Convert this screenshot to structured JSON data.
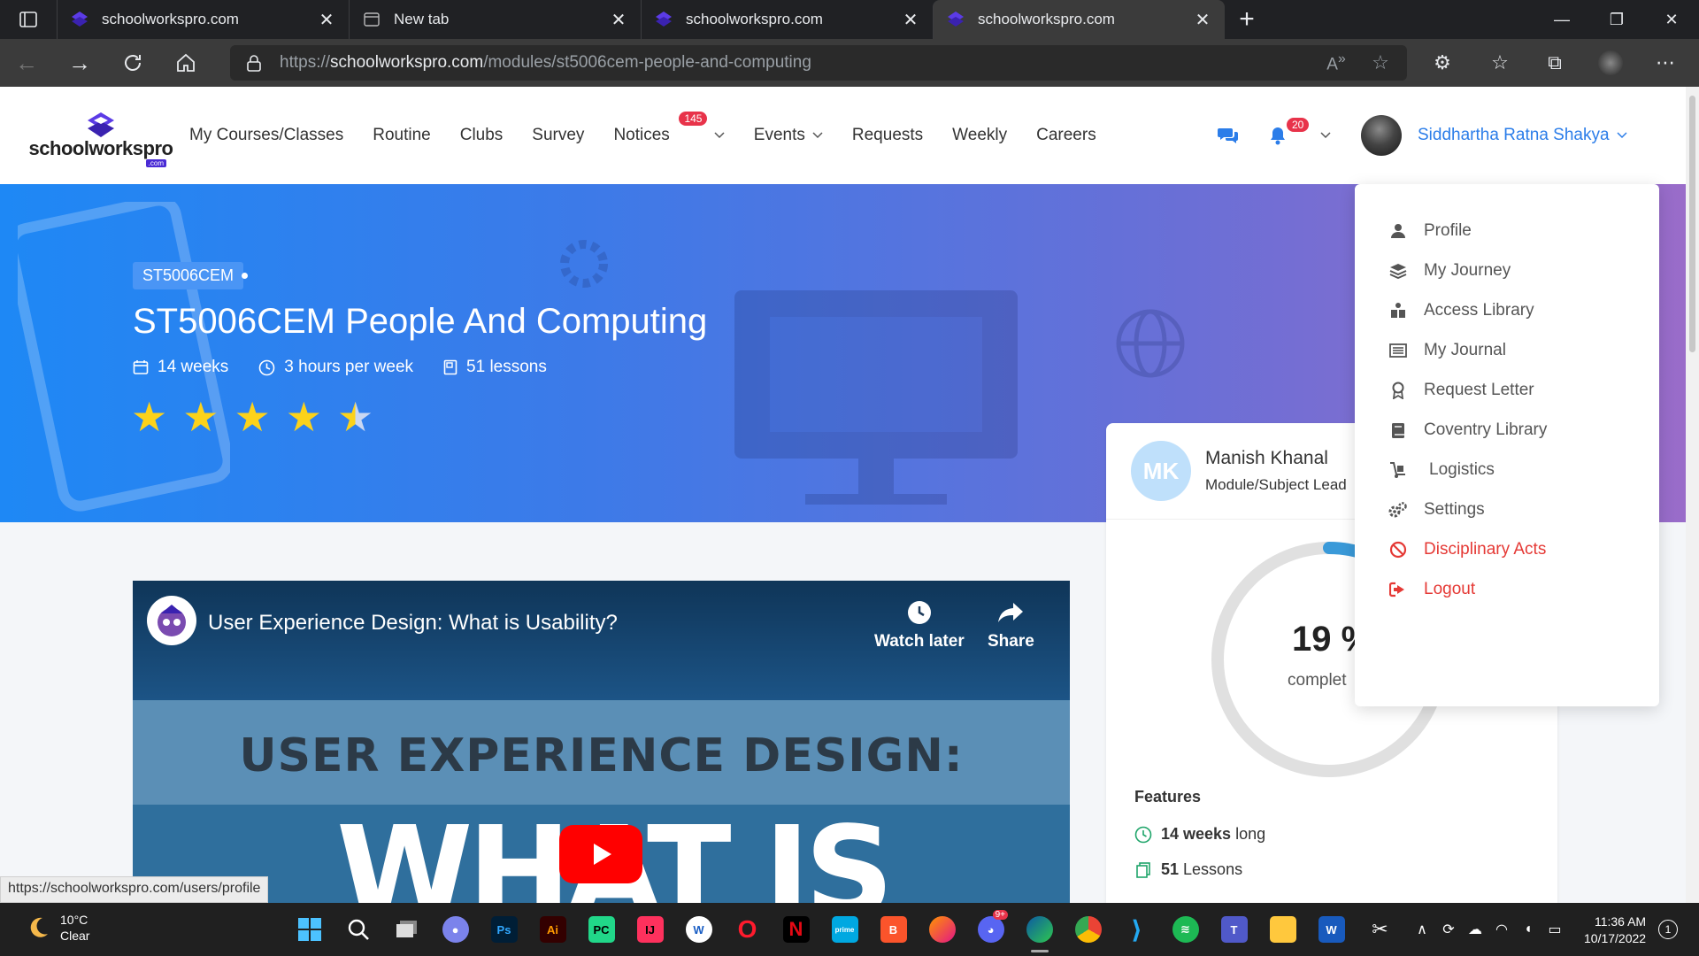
{
  "browser": {
    "tabs": [
      {
        "title": "schoolworkspro.com",
        "icon": "schoolworkspro-icon",
        "active": false
      },
      {
        "title": "New tab",
        "icon": "new-tab-page-icon",
        "active": false
      },
      {
        "title": "schoolworkspro.com",
        "icon": "schoolworkspro-icon",
        "active": false
      },
      {
        "title": "schoolworkspro.com",
        "icon": "schoolworkspro-icon",
        "active": true
      }
    ],
    "url": {
      "scheme": "https://",
      "host": "schoolworkspro.com",
      "path": "/modules/st5006cem-people-and-computing"
    }
  },
  "site": {
    "logo_text": "schoolworkspro",
    "logo_sub": ".com",
    "nav": [
      {
        "label": "My Courses/Classes"
      },
      {
        "label": "Routine"
      },
      {
        "label": "Clubs"
      },
      {
        "label": "Survey"
      },
      {
        "label": "Notices",
        "badge": "145"
      },
      {
        "label": "Events"
      },
      {
        "label": "Requests"
      },
      {
        "label": "Weekly"
      },
      {
        "label": "Careers"
      }
    ],
    "notification_badge": "20",
    "user_name": "Siddhartha Ratna Shakya"
  },
  "hero": {
    "course_code": "ST5006CEM",
    "title": "ST5006CEM People And Computing",
    "duration": "14 weeks",
    "hours": "3 hours per week",
    "lessons": "51 lessons",
    "rating": 4.5,
    "rating_max": 5
  },
  "video": {
    "title": "User Experience Design: What is Usability?",
    "watch_later": "Watch later",
    "share": "Share",
    "heading": "USER EXPERIENCE DESIGN:",
    "big_text": "WHAT IS"
  },
  "sidebar": {
    "instructor_initials": "MK",
    "instructor_name": "Manish Khanal",
    "instructor_role": "Module/Subject Lead",
    "progress_value": "19 %",
    "progress_percent": 19,
    "progress_label": "complet",
    "features_title": "Features",
    "features": [
      {
        "value": "14 weeks",
        "suffix": "long"
      },
      {
        "value": "51",
        "suffix": "Lessons"
      }
    ]
  },
  "user_menu": [
    {
      "label": "Profile",
      "icon": "user-icon"
    },
    {
      "label": "My Journey",
      "icon": "layers-icon"
    },
    {
      "label": "Access Library",
      "icon": "reader-icon"
    },
    {
      "label": "My Journal",
      "icon": "journal-icon"
    },
    {
      "label": "Request Letter",
      "icon": "award-icon"
    },
    {
      "label": "Coventry Library",
      "icon": "book-icon"
    },
    {
      "label": "Logistics",
      "icon": "dolly-icon"
    },
    {
      "label": "Settings",
      "icon": "gears-icon"
    },
    {
      "label": "Disciplinary Acts",
      "icon": "ban-icon",
      "danger": true
    },
    {
      "label": "Logout",
      "icon": "logout-icon",
      "danger": true
    }
  ],
  "status_link": "https://schoolworkspro.com/users/profile",
  "taskbar": {
    "temperature": "10°C",
    "condition": "Clear",
    "time": "11:36 AM",
    "date": "10/17/2022",
    "notifications": "1",
    "discord_badge": "9+"
  },
  "colors": {
    "brand": "#4a2bd5",
    "link": "#2b7de9",
    "badge": "#e8334a",
    "star": "#fcd21a",
    "danger": "#e53935"
  }
}
